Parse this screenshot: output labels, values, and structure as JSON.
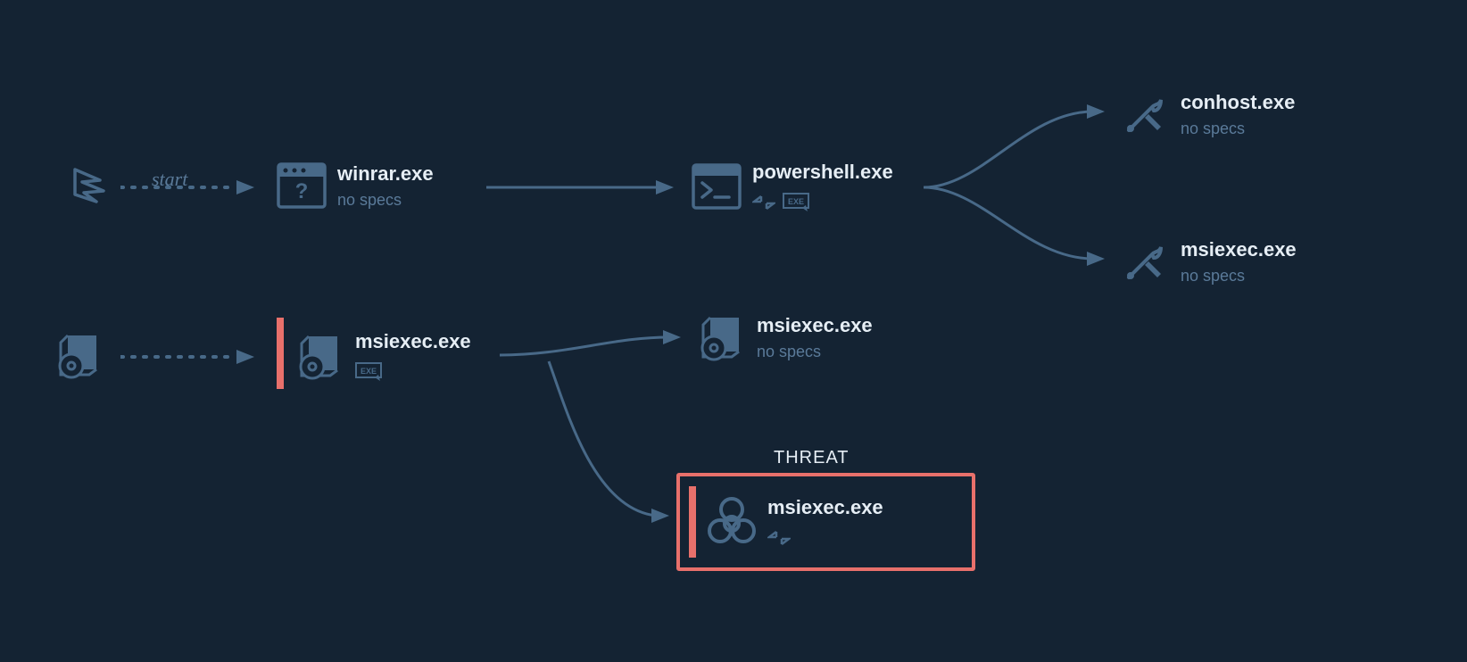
{
  "labels": {
    "start": "start",
    "threat": "THREAT"
  },
  "nodes": {
    "winrar": {
      "title": "winrar.exe",
      "sub": "no specs"
    },
    "powershell": {
      "title": "powershell.exe"
    },
    "conhost": {
      "title": "conhost.exe",
      "sub": "no specs"
    },
    "msiexec_top": {
      "title": "msiexec.exe",
      "sub": "no specs"
    },
    "msiexec_left": {
      "title": "msiexec.exe"
    },
    "msiexec_mid": {
      "title": "msiexec.exe",
      "sub": "no specs"
    },
    "msiexec_threat": {
      "title": "msiexec.exe"
    }
  },
  "colors": {
    "bg": "#142333",
    "icon": "#486988",
    "text": "#e6eef5",
    "subtext": "#5a7a99",
    "threat": "#e8706b"
  }
}
